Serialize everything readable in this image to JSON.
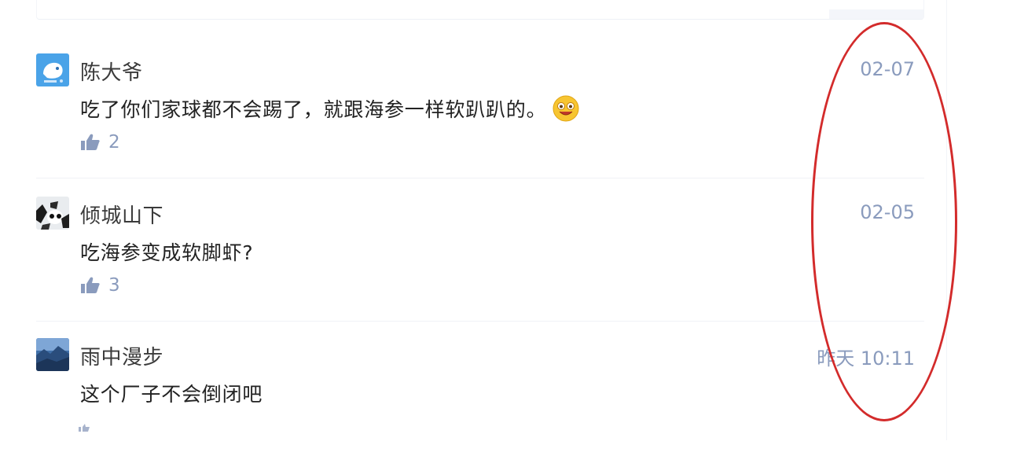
{
  "comments": [
    {
      "username": "陈大爷",
      "timestamp": "02-07",
      "content": "吃了你们家球都不会踢了，就跟海参一样软趴趴的。",
      "likes": "2",
      "has_emoji": true,
      "emoji_icon": "smiley-emoji-icon"
    },
    {
      "username": "倾城山下",
      "timestamp": "02-05",
      "content": "吃海参变成软脚虾?",
      "likes": "3",
      "has_emoji": false
    },
    {
      "username": "雨中漫步",
      "timestamp": "昨天 10:11",
      "content": "这个厂子不会倒闭吧",
      "has_emoji": false
    }
  ],
  "colors": {
    "accent": "#8a9bbd",
    "annotation_ellipse": "#d32b2b",
    "text": "#222222"
  }
}
